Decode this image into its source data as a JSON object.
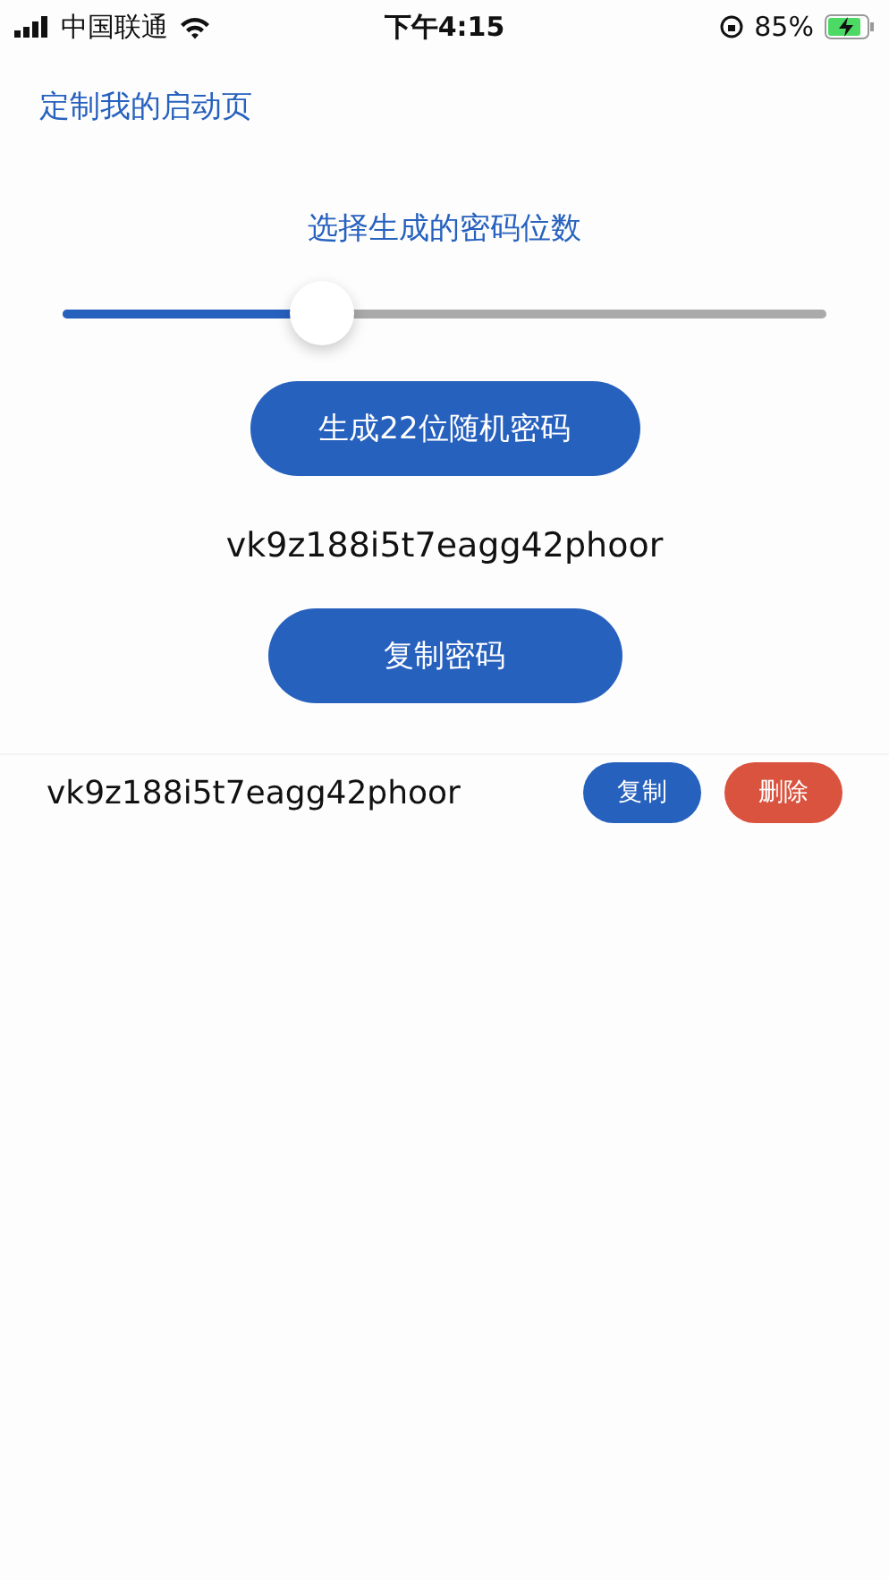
{
  "status_bar": {
    "carrier": "中国联通",
    "time": "下午4:15",
    "battery": "85%"
  },
  "header": {
    "title": "定制我的启动页"
  },
  "length_picker": {
    "label": "选择生成的密码位数",
    "level": 0.34
  },
  "generate_button": "生成22位随机密码",
  "generated_password": "vk9z188i5t7eagg42phoor",
  "copy_button": "复制密码",
  "saved_passwords": [
    {
      "password": "vk9z188i5t7eagg42phoor",
      "actions": [
        {
          "kind": "copy",
          "label": "复制"
        },
        {
          "kind": "delete",
          "label": "删除"
        }
      ]
    }
  ]
}
